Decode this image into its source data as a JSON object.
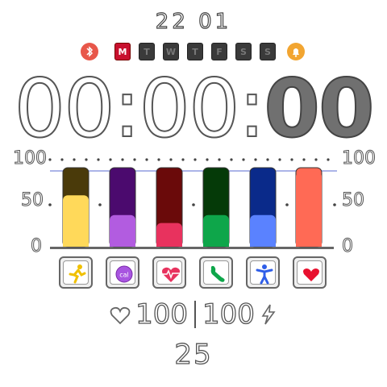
{
  "date": "22 01",
  "weekdays": [
    {
      "label": "M",
      "active": true
    },
    {
      "label": "T",
      "active": false
    },
    {
      "label": "W",
      "active": false
    },
    {
      "label": "T",
      "active": false
    },
    {
      "label": "F",
      "active": false
    },
    {
      "label": "S",
      "active": false
    },
    {
      "label": "S",
      "active": false
    }
  ],
  "time": {
    "hours": "00",
    "minutes": "00",
    "seconds": "00"
  },
  "scale": {
    "top": "100",
    "mid": "50",
    "bottom": "0"
  },
  "colors": {
    "bluetooth": "#e8574a",
    "alarm": "#f2a531",
    "bars": [
      {
        "top": "#4a3a0a",
        "fill": "#ffd95a"
      },
      {
        "top": "#4b0a6e",
        "fill": "#b25ce0"
      },
      {
        "top": "#6a0a0a",
        "fill": "#e8325e"
      },
      {
        "top": "#053a08",
        "fill": "#0ea64a"
      },
      {
        "top": "#0a2a8a",
        "fill": "#5a82ff"
      },
      {
        "top": "#ff6a55",
        "fill": "#ff6a55"
      }
    ]
  },
  "bar_levels": [
    65,
    40,
    30,
    40,
    40,
    95
  ],
  "activities": [
    {
      "icon": "running-person-icon"
    },
    {
      "icon": "calories-icon"
    },
    {
      "icon": "heart-rate-icon"
    },
    {
      "icon": "footprint-icon"
    },
    {
      "icon": "person-icon"
    },
    {
      "icon": "heart-icon"
    }
  ],
  "stats": {
    "heart": "100",
    "battery": "100"
  },
  "steps": "25"
}
